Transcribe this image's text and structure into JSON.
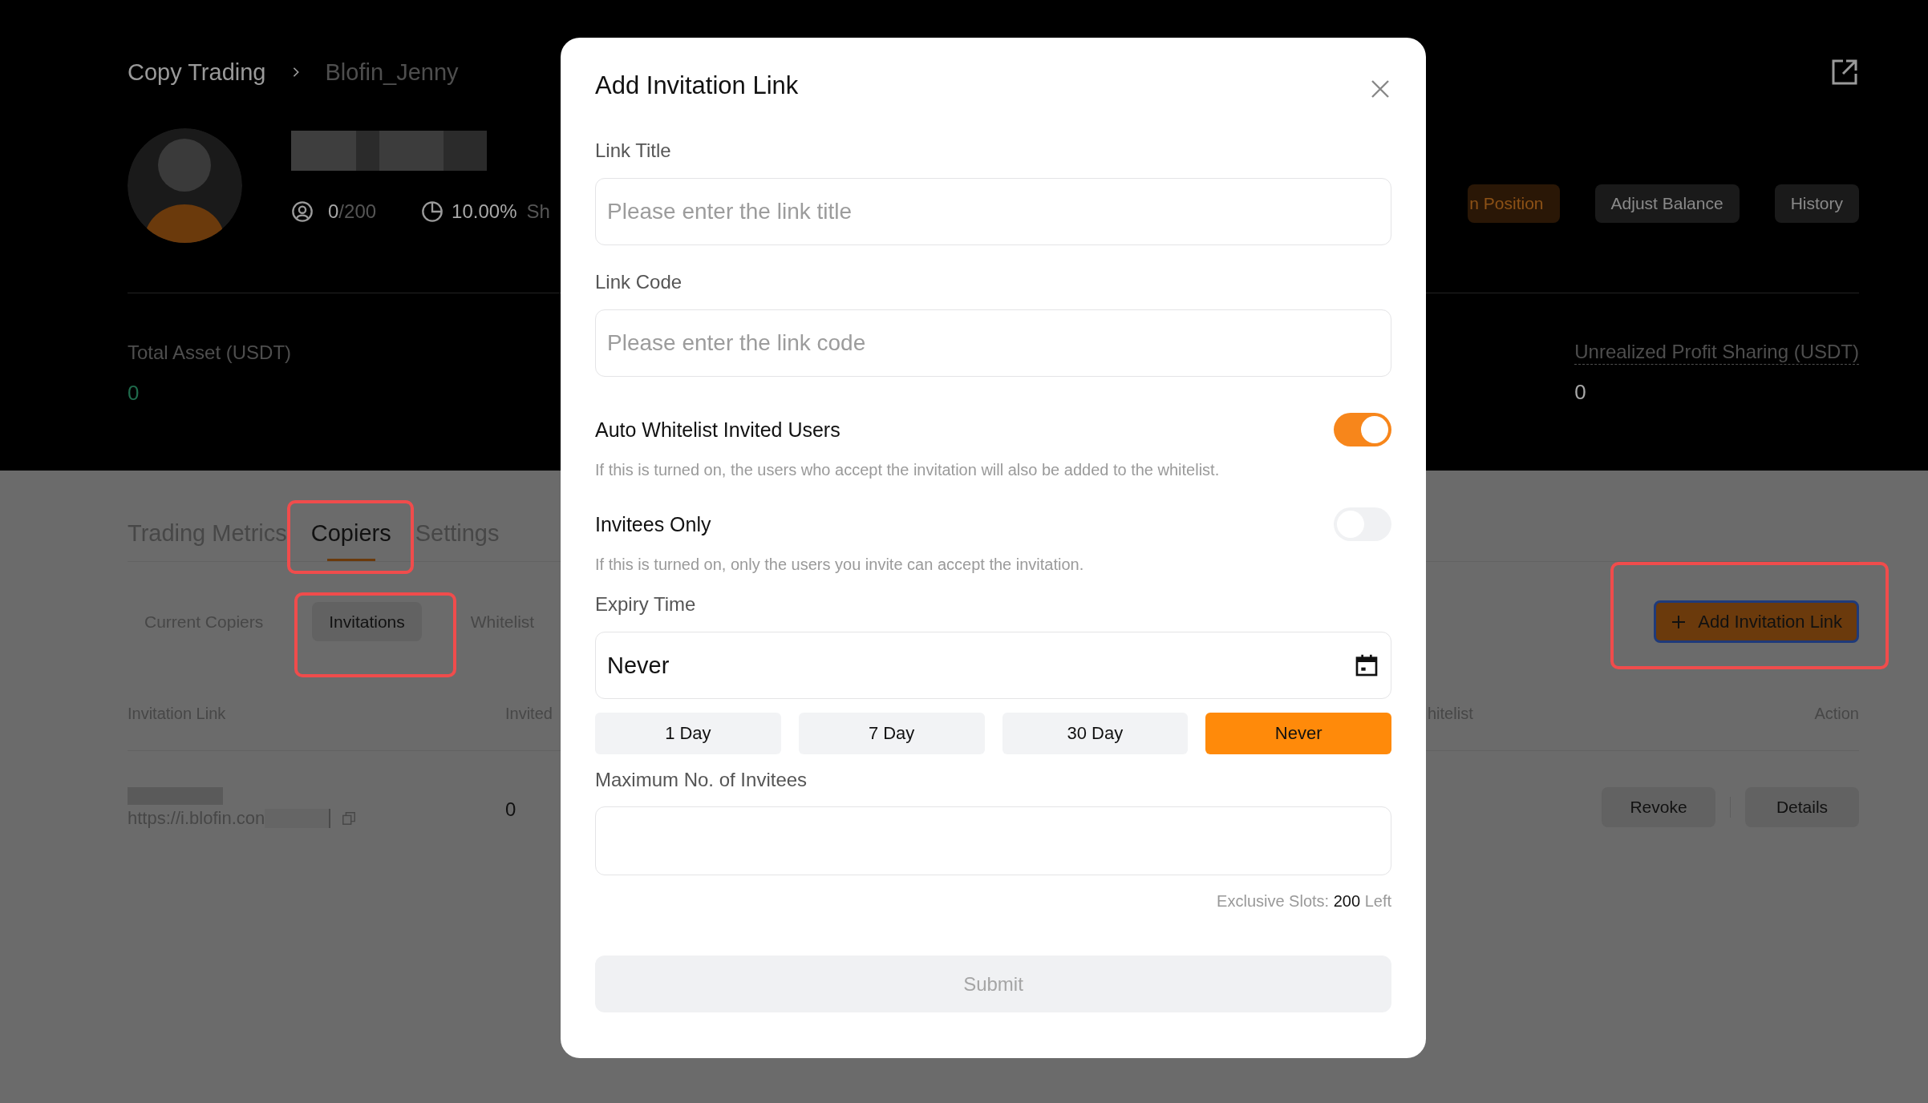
{
  "breadcrumb": [
    {
      "label": "Copy Trading",
      "current": false
    },
    {
      "label": "Blofin_Jenny",
      "current": true
    }
  ],
  "profile": {
    "copiers": "0",
    "copier_limit": "/200",
    "profit_share": "10.00%",
    "profit_share_label": "Sh"
  },
  "header_buttons": [
    {
      "label": "n Position",
      "kind": "accent"
    },
    {
      "label": "Adjust Balance",
      "kind": "plain"
    },
    {
      "label": "History",
      "kind": "plain"
    }
  ],
  "metrics": [
    {
      "label": "Total Asset (USDT)",
      "value": "0",
      "kind": "positive",
      "underlined": false
    },
    {
      "label": "Unrealized Profit Sharing (USDT)",
      "value": "0",
      "kind": "neutral",
      "underlined": true
    }
  ],
  "tabs": [
    {
      "label": "Trading Metrics",
      "selected": false,
      "highlighted": false
    },
    {
      "label": "Copiers",
      "selected": true,
      "highlighted": true
    },
    {
      "label": "Settings",
      "selected": false,
      "highlighted": false
    }
  ],
  "subtabs": [
    {
      "label": "Current Copiers",
      "selected": false,
      "highlighted": false
    },
    {
      "label": "Invitations",
      "selected": true,
      "highlighted": true
    },
    {
      "label": "Whitelist",
      "selected": false,
      "highlighted": false
    }
  ],
  "add_button": {
    "label": "Add Invitation Link",
    "highlighted": true
  },
  "table": {
    "columns": [
      "Invitation Link",
      "Invited",
      "hitelist",
      "Action"
    ],
    "rows": [
      {
        "link": "https://i.blofin.con",
        "invited": "0",
        "actions": [
          "Revoke",
          "Details"
        ]
      }
    ]
  },
  "modal": {
    "title": "Add Invitation Link",
    "link_title": {
      "label": "Link Title",
      "placeholder": "Please enter the link title"
    },
    "link_code": {
      "label": "Link Code",
      "placeholder": "Please enter the link code"
    },
    "switches": [
      {
        "label": "Auto Whitelist Invited Users",
        "on": true,
        "hint": "If this is turned on, the users who accept the invitation will also be added to the whitelist."
      },
      {
        "label": "Invitees Only",
        "on": false,
        "hint": "If this is turned on, only the users you invite can accept the invitation."
      }
    ],
    "expiry": {
      "label": "Expiry Time",
      "value": "Never",
      "options": [
        {
          "label": "1 Day",
          "selected": false
        },
        {
          "label": "7 Day",
          "selected": false
        },
        {
          "label": "30 Day",
          "selected": false
        },
        {
          "label": "Never",
          "selected": true
        }
      ]
    },
    "max_invitees": {
      "label": "Maximum No. of Invitees"
    },
    "slots_note": "Exclusive Slots: **200** Left",
    "submit": {
      "label": "Submit",
      "disabled": true
    }
  }
}
